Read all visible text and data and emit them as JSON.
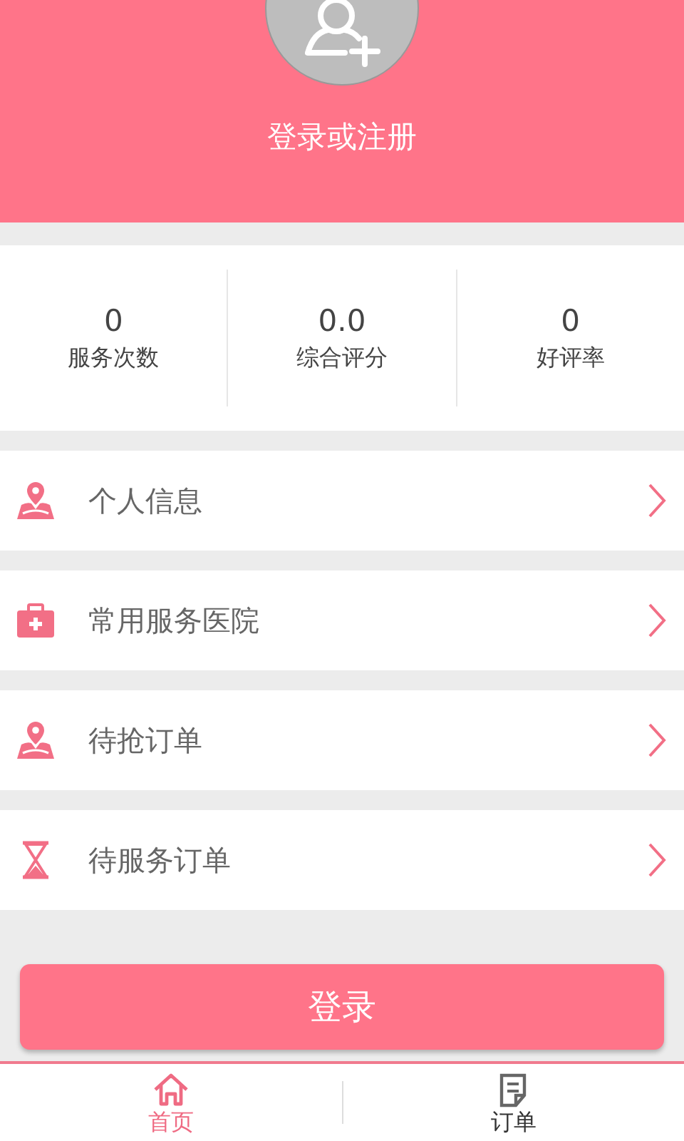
{
  "header": {
    "title": "登录或注册"
  },
  "stats": [
    {
      "value": "0",
      "label": "服务次数"
    },
    {
      "value": "0.0",
      "label": "综合评分"
    },
    {
      "value": "0",
      "label": "好评率"
    }
  ],
  "menu": [
    {
      "kind": "person-pin",
      "label": "个人信息"
    },
    {
      "kind": "medkit",
      "label": "常用服务医院"
    },
    {
      "kind": "person-pin",
      "label": "待抢订单"
    },
    {
      "kind": "hourglass",
      "label": "待服务订单"
    }
  ],
  "login_button": "登录",
  "tabs": [
    {
      "kind": "home",
      "label": "首页",
      "selected": true
    },
    {
      "kind": "order",
      "label": "订单",
      "selected": false
    }
  ]
}
